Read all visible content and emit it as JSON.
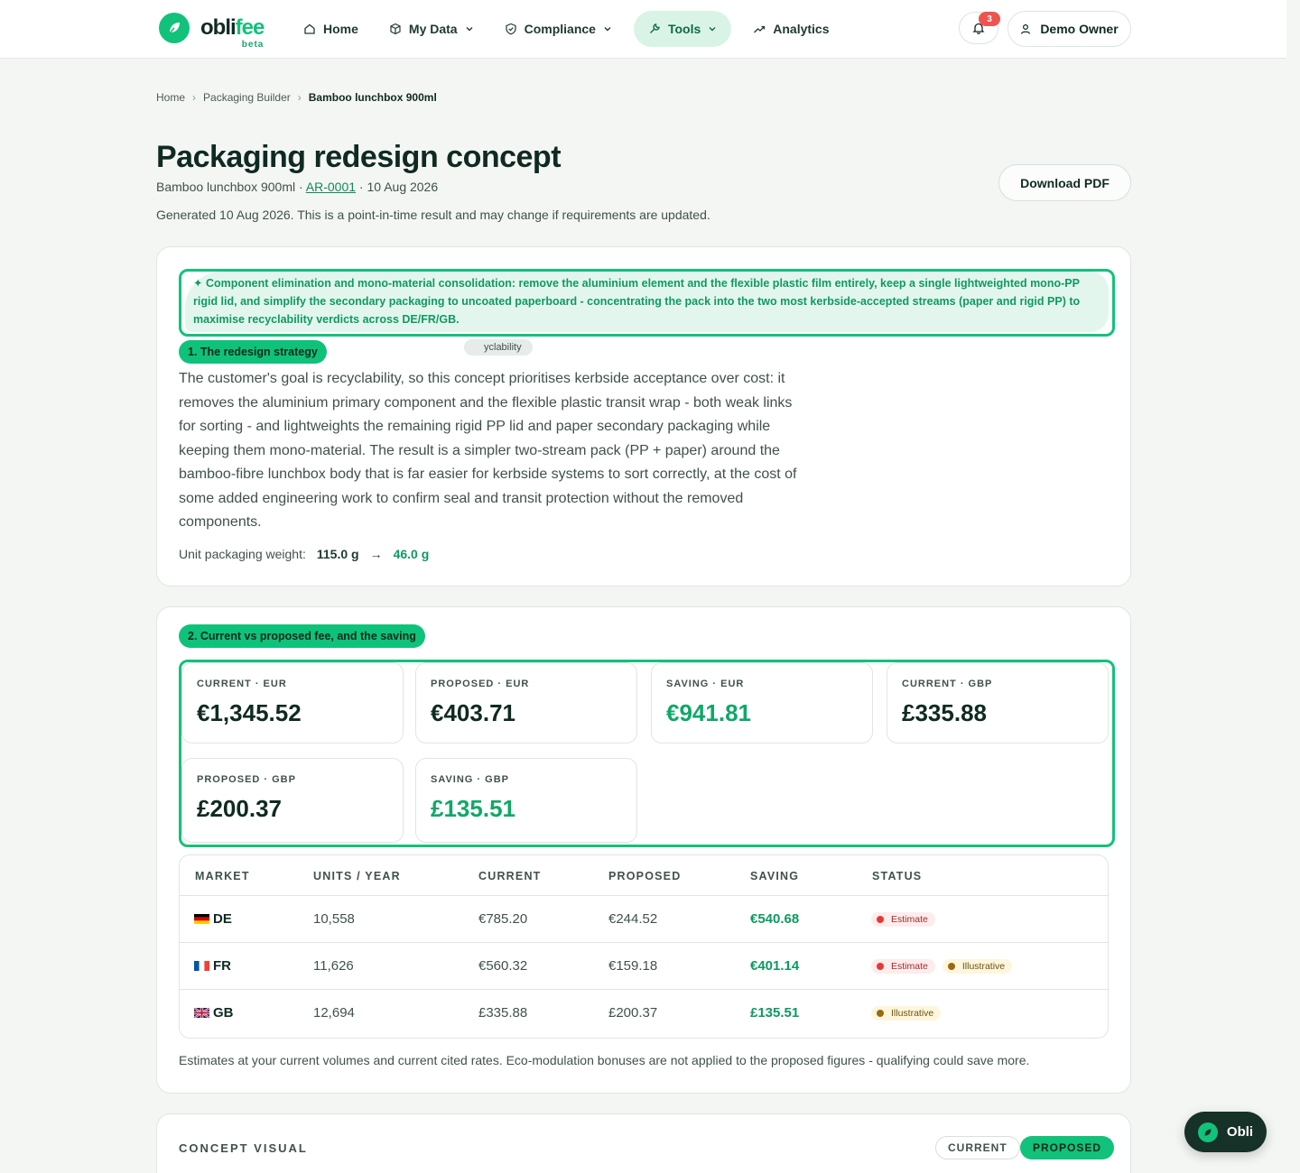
{
  "brand": {
    "name_a": "obli",
    "name_b": "fee",
    "badge": "beta",
    "accent": "#12c27a"
  },
  "nav": {
    "home": "Home",
    "my_data": "My Data",
    "compliance": "Compliance",
    "tools": "Tools",
    "analytics": "Analytics"
  },
  "notifications": {
    "count": "3"
  },
  "user": {
    "name": "Demo Owner"
  },
  "breadcrumb": [
    "Home",
    "Packaging Builder",
    "Bamboo lunchbox 900ml"
  ],
  "page": {
    "title": "Packaging redesign concept",
    "product": "Bamboo lunchbox 900ml",
    "ref": "AR-0001",
    "date": "10 Aug 2026",
    "generated": "Generated 10 Aug 2026. This is a point-in-time result and may change if requirements are updated.",
    "download": "Download PDF"
  },
  "strategy": {
    "headline": "✦ Component elimination and mono-material consolidation: remove the aluminium element and the flexible plastic film entirely, keep a single lightweighted mono-PP rigid lid, and simplify the secondary packaging to uncoated paperboard - concentrating the pack into the two most kerbside-accepted streams (paper and rigid PP) to maximise recyclability verdicts across DE/FR/GB.",
    "section_label": "1. The redesign strategy",
    "goal_pill": "yclability",
    "body": "The customer's goal is recyclability, so this concept prioritises kerbside acceptance over cost: it removes the aluminium primary component and the flexible plastic transit wrap - both weak links for sorting - and lightweights the remaining rigid PP lid and paper secondary packaging while keeping them mono-material. The result is a simpler two-stream pack (PP + paper) around the bamboo-fibre lunchbox body that is far easier for kerbside systems to sort correctly, at the cost of some added engineering work to confirm seal and transit protection without the removed components.",
    "weight_label": "Unit packaging weight:",
    "weight_from": "115.0 g",
    "weight_arrow": "→",
    "weight_to": "46.0 g"
  },
  "fees": {
    "section_label": "2. Current vs proposed fee, and the saving",
    "tiles": [
      {
        "label": "CURRENT · EUR",
        "value": "€1,345.52"
      },
      {
        "label": "PROPOSED · EUR",
        "value": "€403.71"
      },
      {
        "label": "SAVING · EUR",
        "value": "€941.81"
      },
      {
        "label": "CURRENT · GBP",
        "value": "£335.88"
      },
      {
        "label": "PROPOSED · GBP",
        "value": "£200.37"
      },
      {
        "label": "SAVING · GBP",
        "value": "£135.51"
      }
    ],
    "table": {
      "headers": [
        "MARKET",
        "UNITS / YEAR",
        "CURRENT",
        "PROPOSED",
        "SAVING",
        "STATUS"
      ],
      "rows": [
        {
          "market": "DE",
          "units": "10,558",
          "current": "€785.20",
          "proposed": "€244.52",
          "saving": "€540.68",
          "status": [
            "Estimate"
          ]
        },
        {
          "market": "FR",
          "units": "11,626",
          "current": "€560.32",
          "proposed": "€159.18",
          "saving": "€401.14",
          "status": [
            "Estimate",
            "Illustrative"
          ]
        },
        {
          "market": "GB",
          "units": "12,694",
          "current": "£335.88",
          "proposed": "£200.37",
          "saving": "£135.51",
          "status": [
            "Illustrative"
          ]
        }
      ]
    },
    "note": "Estimates at your current volumes and current cited rates. Eco-modulation bonuses are not applied to the proposed figures - qualifying could save more."
  },
  "visual": {
    "title": "CONCEPT VISUAL",
    "toggle_current": "CURRENT",
    "toggle_proposed": "PROPOSED"
  },
  "assistant": {
    "label": "Obli"
  }
}
